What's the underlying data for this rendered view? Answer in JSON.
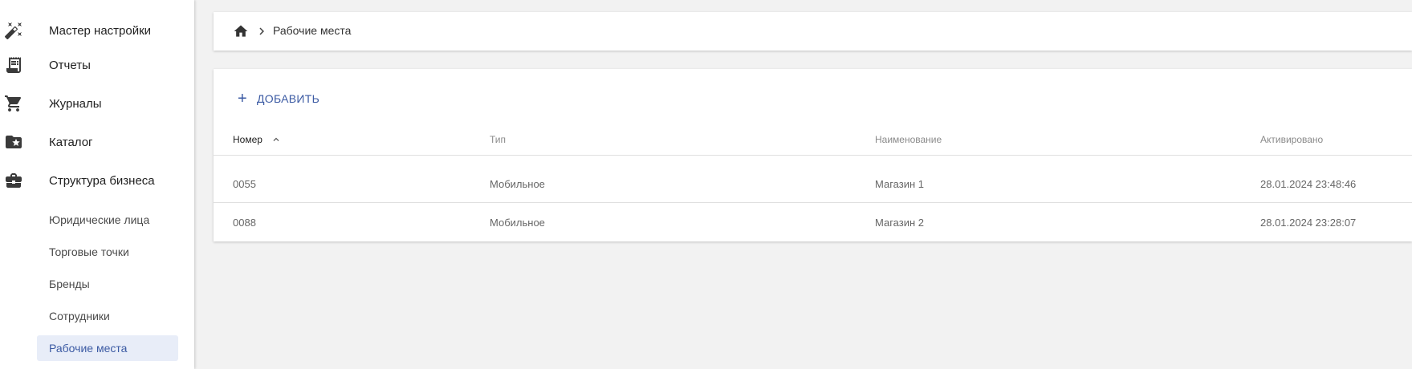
{
  "sidebar": {
    "items": [
      {
        "label": "Мастер настройки",
        "icon": "magic-wand-icon"
      },
      {
        "label": "Отчеты",
        "icon": "receipt-icon"
      },
      {
        "label": "Журналы",
        "icon": "cart-icon"
      },
      {
        "label": "Каталог",
        "icon": "folder-star-icon"
      },
      {
        "label": "Структура бизнеса",
        "icon": "briefcase-icon"
      }
    ],
    "sub_items": [
      {
        "label": "Юридические лица"
      },
      {
        "label": "Торговые точки"
      },
      {
        "label": "Бренды"
      },
      {
        "label": "Сотрудники"
      },
      {
        "label": "Рабочие места",
        "active": true
      }
    ]
  },
  "breadcrumb": {
    "home_icon": "home-icon",
    "separator_icon": "chevron-right-icon",
    "current": "Рабочие места"
  },
  "toolbar": {
    "add_label": "ДОБАВИТЬ"
  },
  "table": {
    "columns": [
      "Номер",
      "Тип",
      "Наименование",
      "Активировано"
    ],
    "sorted_column": "Номер",
    "sort_direction": "asc",
    "rows": [
      [
        "0055",
        "Мобильное",
        "Магазин 1",
        "28.01.2024 23:48:46"
      ],
      [
        "0088",
        "Мобильное",
        "Магазин 2",
        "28.01.2024 23:28:07"
      ]
    ]
  },
  "colors": {
    "accent": "#3b5aa3",
    "active_bg": "#e8edf8",
    "page_bg": "#f2f2f2"
  }
}
